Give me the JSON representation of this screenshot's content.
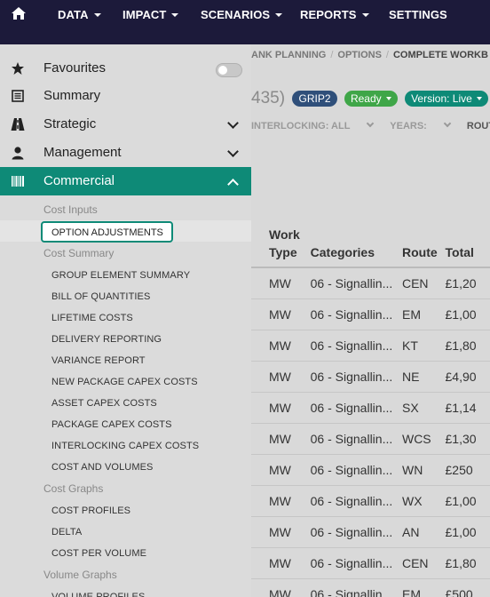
{
  "topnav": {
    "items": [
      {
        "label": "DATA",
        "caret": true
      },
      {
        "label": "IMPACT",
        "caret": true
      },
      {
        "label": "SCENARIOS",
        "caret": true
      },
      {
        "label": "REPORTS",
        "caret": true
      },
      {
        "label": "SETTINGS",
        "caret": false
      }
    ]
  },
  "breadcrumb": [
    "ANK PLANNING",
    "OPTIONS",
    "COMPLETE WORKB"
  ],
  "title_fragment": "435)",
  "badges": [
    {
      "label": "GRIP2",
      "color": "#2f4f7a",
      "caret": false
    },
    {
      "label": "Ready",
      "color": "#3fa648",
      "caret": true
    },
    {
      "label": "Version: Live",
      "color": "#0e8a77",
      "caret": true
    }
  ],
  "filters": [
    {
      "label": "INTERLOCKING: ALL",
      "chevron": true
    },
    {
      "label": "YEARS:",
      "chevron": true
    },
    {
      "label": "ROUTE: ALL",
      "chevron": false
    }
  ],
  "table": {
    "headers": [
      "Work Type",
      "Categories",
      "Route",
      "Total"
    ],
    "rows": [
      [
        "MW",
        "06 - Signallin...",
        "CEN",
        "£1,20"
      ],
      [
        "MW",
        "06 - Signallin...",
        "EM",
        "£1,00"
      ],
      [
        "MW",
        "06 - Signallin...",
        "KT",
        "£1,80"
      ],
      [
        "MW",
        "06 - Signallin...",
        "NE",
        "£4,90"
      ],
      [
        "MW",
        "06 - Signallin...",
        "SX",
        "£1,14"
      ],
      [
        "MW",
        "06 - Signallin...",
        "WCS",
        "£1,30"
      ],
      [
        "MW",
        "06 - Signallin...",
        "WN",
        "£250"
      ],
      [
        "MW",
        "06 - Signallin...",
        "WX",
        "£1,00"
      ],
      [
        "MW",
        "06 - Signallin...",
        "AN",
        "£1,00"
      ],
      [
        "MW",
        "06 - Signallin...",
        "CEN",
        "£1,80"
      ],
      [
        "MW",
        "06 - Signallin...",
        "EM",
        "£500"
      ]
    ]
  },
  "sidebar": {
    "items": [
      {
        "label": "Favourites",
        "icon": "star-icon"
      },
      {
        "label": "Summary",
        "icon": "summary-icon"
      },
      {
        "label": "Strategic",
        "icon": "road-icon"
      },
      {
        "label": "Management",
        "icon": "user-icon"
      },
      {
        "label": "Commercial",
        "icon": "barcode-icon"
      }
    ],
    "commercial": {
      "cost_inputs_heading": "Cost Inputs",
      "option_adjustments": "OPTION ADJUSTMENTS",
      "cost_summary_heading": "Cost Summary",
      "cost_summary_links": [
        "GROUP ELEMENT SUMMARY",
        "BILL OF QUANTITIES",
        "LIFETIME COSTS",
        "DELIVERY REPORTING",
        "VARIANCE REPORT",
        "NEW PACKAGE CAPEX COSTS",
        "ASSET CAPEX COSTS",
        "PACKAGE CAPEX COSTS",
        "INTERLOCKING CAPEX COSTS",
        "COST AND VOLUMES"
      ],
      "cost_graphs_heading": "Cost Graphs",
      "cost_graphs_links": [
        "COST PROFILES",
        "DELTA",
        "COST PER VOLUME"
      ],
      "volume_graphs_heading": "Volume Graphs",
      "volume_graphs_links": [
        "VOLUME PROFILES"
      ]
    }
  },
  "colors": {
    "nav_bg": "#1c1a3a",
    "accent": "#0e8a77",
    "overlay_bg": "#d9d9d9"
  }
}
